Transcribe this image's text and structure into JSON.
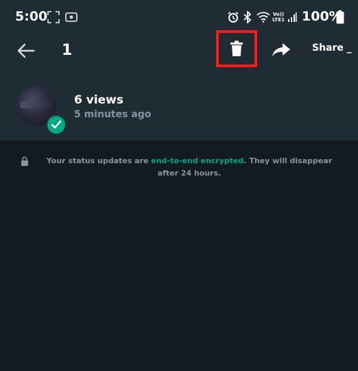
{
  "status_bar": {
    "time": "5:00",
    "battery": "100%",
    "network_label": "LTE1"
  },
  "action_bar": {
    "selected_count": "1",
    "share_label": "Share _"
  },
  "status_item": {
    "views": "6 views",
    "time_ago": "5 minutes ago"
  },
  "info": {
    "text_before": "Your status updates are ",
    "link": "end-to-end encrypted",
    "text_after": ". They will disappear after 24 hours."
  },
  "colors": {
    "background": "#121b22",
    "header": "#1f2c34",
    "accent": "#00a884",
    "highlight_box": "#ff1a1a",
    "muted_text": "#8696a0"
  },
  "icons": [
    "back-arrow-icon",
    "delete-icon",
    "share-forward-icon",
    "lock-icon",
    "check-icon",
    "alarm-icon",
    "bluetooth-icon",
    "wifi-icon",
    "signal-icon",
    "battery-icon",
    "screenshot-icon",
    "cast-icon"
  ]
}
